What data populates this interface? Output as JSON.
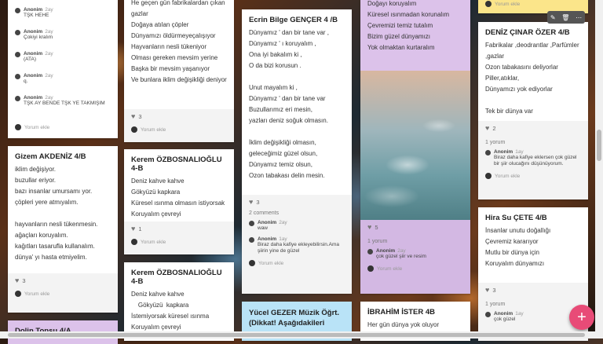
{
  "like_counts": {
    "c1_2": "3",
    "c2_1": "3",
    "c2_2": "1",
    "c3_1": "3",
    "c4_1": "5",
    "c5_1": "2",
    "c5_2": "3"
  },
  "col1": {
    "card1": {
      "comments": [
        {
          "name": "Anonim",
          "time": "2ay",
          "text": "TŞK HEHE"
        },
        {
          "name": "Anonim",
          "time": "2ay",
          "text": "Çokiyi kralım"
        },
        {
          "name": "Anonim",
          "time": "2ay",
          "text": "(ATA)"
        },
        {
          "name": "Anonim",
          "time": "2ay",
          "text": "q."
        },
        {
          "name": "Anonim",
          "time": "2ay",
          "text": "TŞK AY BENDE TŞK YE TAKMIŞIM"
        }
      ],
      "add_comment": "Yorum ekle"
    },
    "card2": {
      "title": "Gizem AKDENİZ 4/B",
      "lines": [
        "iklim değişiyor.",
        "buzullar eriyor.",
        "bazı insanlar umursamı yor.",
        "çöpleri yere atmıyalım.",
        "",
        "hayvanların nesli tükenmesin.",
        "ağaçları koruyalım.",
        "kağıtları tasarufla kullanalım.",
        "dünya' yı hasta etmiyelim."
      ],
      "add_comment": "Yorum ekle"
    },
    "card3": {
      "title": "Dolin Topsu 4/A"
    }
  },
  "col2": {
    "card1": {
      "lines": [
        "He geçen gün fabrikalardan çıkan",
        "gazlar",
        "Doğaya atılan çöpler",
        "Dünyamızı öldürmeyeçalışıyor",
        "Hayvanların nesli tükeniyor",
        "Olması gereken mevsim yerine",
        "Başka bir mevsim yaşanıyor",
        "Ve bunlara iklim değişikliği deniyor"
      ],
      "add_comment": "Yorum ekle"
    },
    "card2": {
      "title": "Kerem ÖZBOSNALIOĞLU 4-B",
      "lines": [
        "Deniz kahve kahve",
        "Gökyüzü kapkara",
        "Küresel ısınma olmasın istiyorsak",
        "Koruyalım çevreyi"
      ],
      "add_comment": "Yorum ekle"
    },
    "card3": {
      "title": "Kerem ÖZBOSNALIOĞLU 4-B",
      "lines": [
        "Deniz kahve kahve",
        "    Gökyüzü  kapkara",
        "İstemiyorsak küresel ısınma",
        "Koruyalım  çevreyi"
      ]
    }
  },
  "col3": {
    "card1": {
      "title": "Ecrin Bilge GENÇER 4 /B",
      "lines": [
        "Dünyamız  ' dan  bir tane  var ,",
        "Dünyamız  ' ı  koruyalım ,",
        "Ona  iyi bakalım  ki ,",
        "O da bizi korusun .",
        "",
        "Unut mayalım ki ,",
        "Dünyamız ' dan  bir tane  var",
        "Buzullarımız eri mesin,",
        "yazları deniz soğuk olmasın.",
        "",
        "İklim değişikliği olmasın,",
        "geleceğimiz güzel olsun,",
        "Dünyamız temiz olsun,",
        "Ozon  tabakası delin mesin."
      ],
      "comment_count": "2 comments",
      "comments": [
        {
          "name": "Anonim",
          "time": "2ay",
          "text": "waw"
        },
        {
          "name": "Anonim",
          "time": "1ay",
          "text": "Biraz daha kafiye ekleyebilirsin.Ama şiirin yine de güzel"
        }
      ],
      "add_comment": "Yorum ekle"
    },
    "card2": {
      "title": "Yücel GEZER Müzik Öğrt. (Dikkat! Aşağıdakileri"
    }
  },
  "col4": {
    "card1": {
      "lines": [
        "Doğayı koruyalım",
        "Küresel ısınmadan korunalım",
        "Çevremizi temiz tutalım",
        "Bizim güzel dünyamızı",
        "Yok olmaktan kurtaralım"
      ],
      "comment_count": "1 yorum",
      "comments": [
        {
          "name": "Anonim",
          "time": "2ay",
          "text": "çok güzel şiir ve resim"
        }
      ],
      "add_comment": "Yorum ekle"
    },
    "card2": {
      "title": "İBRAHİM İSTER 4B",
      "lines": [
        "Her gün dünya yok oluyor"
      ]
    }
  },
  "col5": {
    "card0": {
      "add_comment": "Yorum ekle"
    },
    "card1": {
      "title": "DENİZ ÇINAR ÖZER 4/B",
      "lines": [
        "Fabrikalar ,deodrantlar ,Parfümler",
        ",gazlar",
        "Ozon tabakasını deliyorlar",
        "Piller,atıklar,",
        "Dünyamızı yok ediyorlar",
        "",
        "Tek bir dünya var"
      ],
      "comment_count": "1 yorum",
      "comments": [
        {
          "name": "Anonim",
          "time": "1ay",
          "text": "Biraz daha kafiye eklersen çok güzel bir şiir olucağını düşünüyorum."
        }
      ],
      "add_comment": "Yorum ekle"
    },
    "card2": {
      "title": "Hira Su ÇETE 4/B",
      "lines": [
        "İnsanlar unutu doğallığı",
        "Çevremiz kararıyor",
        "Mutlu bir dünya için",
        "Koruyalım dünyamızı"
      ],
      "comment_count": "1 yorum",
      "comments": [
        {
          "name": "Anonim",
          "time": "1ay",
          "text": "çok güzel"
        }
      ]
    }
  },
  "toolbar": {
    "edit": "edit-icon",
    "delete": "trash-icon",
    "more": "more-icon"
  },
  "fab": {
    "label": "+"
  }
}
